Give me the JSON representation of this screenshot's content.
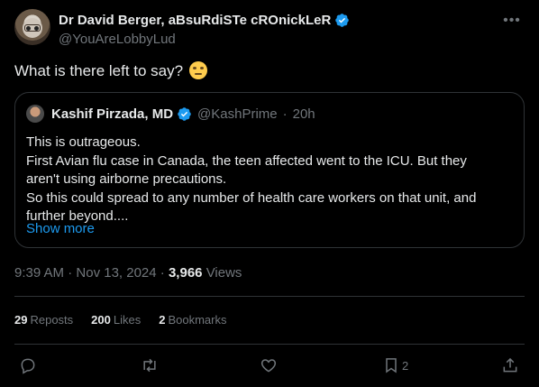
{
  "author": {
    "display_name": "Dr David Berger, aBsuRdiSTe cROnickLeR",
    "handle": "@YouAreLobbyLud"
  },
  "tweet": {
    "text": "What is there left to say?",
    "emoji": "face-with-rolling-eyes"
  },
  "quote": {
    "display_name": "Kashif Pirzada, MD",
    "handle": "@KashPrime",
    "separator": "·",
    "time": "20h",
    "lines": [
      "This is outrageous.",
      "First Avian flu case in Canada, the teen affected went to the ICU. But they aren't using airborne precautions.",
      "So this could spread to any number of health care workers on that unit, and further beyond...."
    ],
    "show_more": "Show more"
  },
  "meta": {
    "time": "9:39 AM",
    "sep1": "·",
    "date": "Nov 13, 2024",
    "sep2": "·",
    "views_count": "3,966",
    "views_label": "Views"
  },
  "stats": {
    "reposts_count": "29",
    "reposts_label": "Reposts",
    "likes_count": "200",
    "likes_label": "Likes",
    "bookmarks_count": "2",
    "bookmarks_label": "Bookmarks"
  },
  "actions": {
    "bookmark_count": "2"
  },
  "colors": {
    "background": "#000000",
    "text": "#e7e9ea",
    "secondary": "#71767b",
    "accent": "#1d9bf0",
    "border": "#2f3336"
  }
}
